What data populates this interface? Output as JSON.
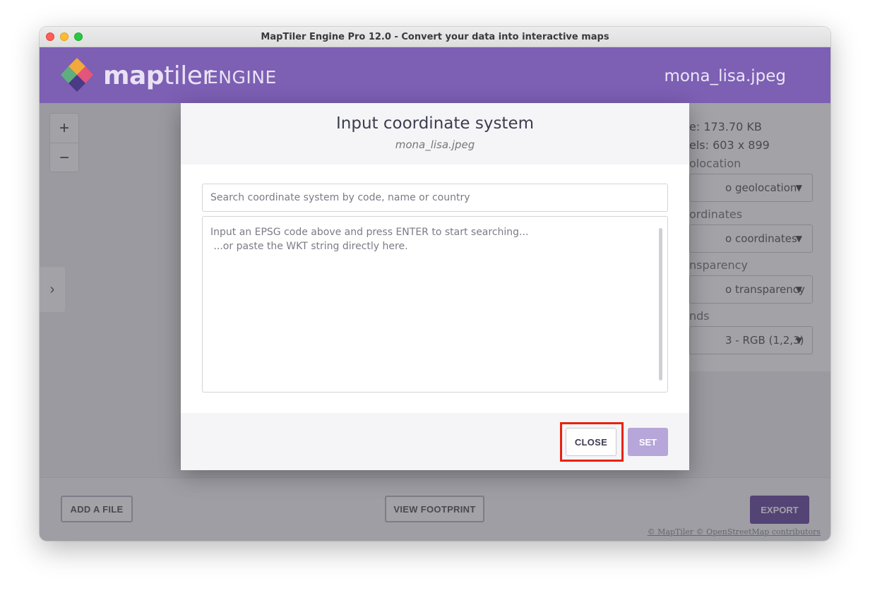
{
  "window": {
    "title": "MapTiler Engine Pro 12.0 - Convert your data into interactive maps"
  },
  "header": {
    "logo_main": "maptiler",
    "logo_bold": "map",
    "logo_light": "tiler",
    "logo_engine": "ENGINE",
    "file_name": "mona_lisa.jpeg"
  },
  "map": {
    "zoom_in": "+",
    "zoom_out": "−",
    "side_toggle": "›"
  },
  "right_panel": {
    "size": "e: 173.70 KB",
    "pixels": "els: 603 x 899",
    "geolocation_label": "olocation",
    "geolocation_value": "o geolocation",
    "coordinates_label": "ordinates",
    "coordinates_value": "o coordinates",
    "transparency_label": "nsparency",
    "transparency_value": "o transparency",
    "bands_label": "nds",
    "bands_value": "3 - RGB (1,2,3)"
  },
  "bottom": {
    "add_file": "ADD A FILE",
    "view_footprint": "VIEW FOOTPRINT",
    "export": "EXPORT",
    "attribution": "© MapTiler © OpenStreetMap contributors"
  },
  "modal": {
    "title": "Input coordinate system",
    "subtitle": "mona_lisa.jpeg",
    "search_placeholder": "Search coordinate system by code, name or country",
    "wkt_hint_line1": "Input an EPSG code above and press ENTER to start searching...",
    "wkt_hint_line2": " ...or paste the WKT string directly here.",
    "close_label": "CLOSE",
    "set_label": "SET"
  },
  "colors": {
    "brand_purple": "#7d5fb4",
    "export_purple": "#6a4a9f",
    "set_disabled": "#b7a6d9",
    "highlight_red": "#e8220f"
  },
  "icons": {
    "dropdown": "caret-down-icon",
    "side_toggle": "chevron-right-icon"
  }
}
